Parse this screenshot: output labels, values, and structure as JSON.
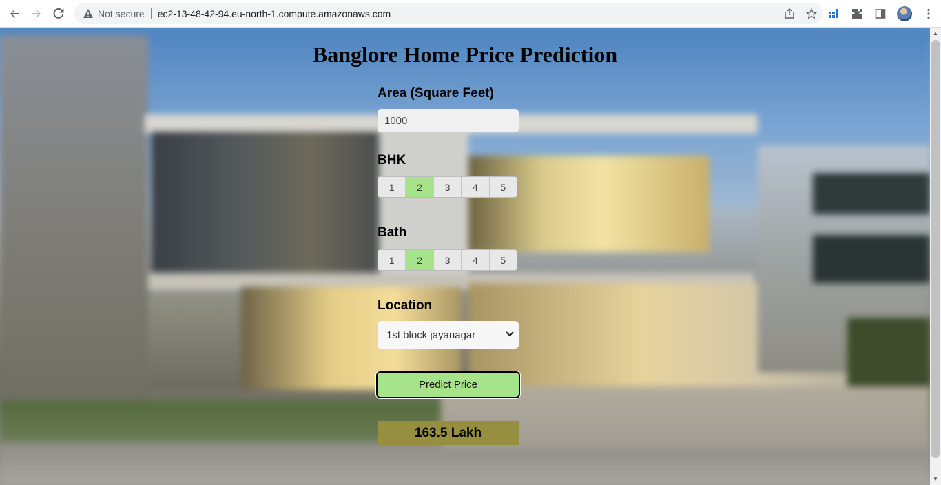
{
  "browser": {
    "security_label": "Not secure",
    "url": "ec2-13-48-42-94.eu-north-1.compute.amazonaws.com"
  },
  "page": {
    "title": "Banglore Home Price Prediction",
    "area": {
      "label": "Area (Square Feet)",
      "value": "1000"
    },
    "bhk": {
      "label": "BHK",
      "options": [
        "1",
        "2",
        "3",
        "4",
        "5"
      ],
      "selected": "2"
    },
    "bath": {
      "label": "Bath",
      "options": [
        "1",
        "2",
        "3",
        "4",
        "5"
      ],
      "selected": "2"
    },
    "location": {
      "label": "Location",
      "selected": "1st block jayanagar"
    },
    "predict_button": "Predict Price",
    "result": "163.5 Lakh"
  },
  "colors": {
    "selected_option": "#a6e38a",
    "predict_button": "#a6e38a",
    "result_background": "#958f3f"
  }
}
